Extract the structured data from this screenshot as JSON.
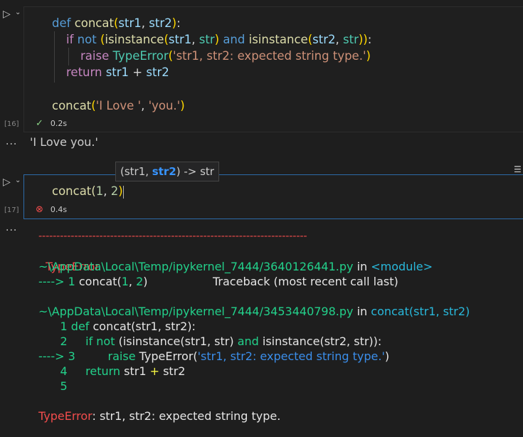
{
  "cell16": {
    "lines": [
      [
        "def",
        "concat(str1, str2):"
      ],
      [
        "if",
        "not",
        "(isinstance(str1, str)",
        "and",
        "isinstance(str2, str)):"
      ],
      [
        "raise",
        "TypeError",
        "'str1, str2: expected string type.'"
      ],
      [
        "return",
        "str1 + str2"
      ],
      [],
      [
        "concat(",
        "'I Love '",
        ", ",
        "'you.'",
        ")"
      ]
    ],
    "exec_count": "[16]",
    "time": "0.2s"
  },
  "output16": {
    "ellipsis": "...",
    "text": "'I Love you.'"
  },
  "cell17": {
    "code_prefix": "concat(",
    "arg1": "1",
    "sep": ", ",
    "arg2": "2",
    "code_suffix": ")",
    "exec_count": "[17]",
    "time": "0.4s"
  },
  "tooltip": {
    "open": "(str1, ",
    "param": "str2",
    "close": ") -> str"
  },
  "output17": {
    "ellipsis": "...",
    "separator": "---------------------------------------------------------------------------",
    "error_name": "TypeError",
    "traceback_header": "Traceback (most recent call last)",
    "frame1_path": "~\\AppData\\Local\\Temp/ipykernel_7444/3640126441.py",
    "frame1_in": " in ",
    "frame1_fn": "<module>",
    "frame1_arrow": "----> 1 ",
    "frame1_code": "concat(",
    "frame1_a1": "1",
    "frame1_sep": ", ",
    "frame1_a2": "2",
    "frame1_close": ")",
    "frame2_path": "~\\AppData\\Local\\Temp/ipykernel_7444/3453440798.py",
    "frame2_in": " in ",
    "frame2_fn": "concat(str1, str2)",
    "l1_num": "      1 ",
    "l1_def": "def",
    "l1_rest": " concat(str1, str2):",
    "l2_num": "      2 ",
    "l2_if": "    if",
    "l2_not": " not",
    "l2_rest1": " (isinstance(str1, str)",
    "l2_and": " and",
    "l2_rest2": " isinstance(str2, str)):",
    "l3_num": "----> 3 ",
    "l3_raise": "        raise",
    "l3_cls": " TypeError(",
    "l3_str": "'str1, str2: expected string type.'",
    "l3_close": ")",
    "l4_num": "      4 ",
    "l4_return": "    return",
    "l4_rest": " str1 ",
    "l4_plus": "+",
    "l4_rest2": " str2",
    "l5_num": "      5 ",
    "final_name": "TypeError",
    "final_msg": ": str1, str2: expected string type."
  }
}
